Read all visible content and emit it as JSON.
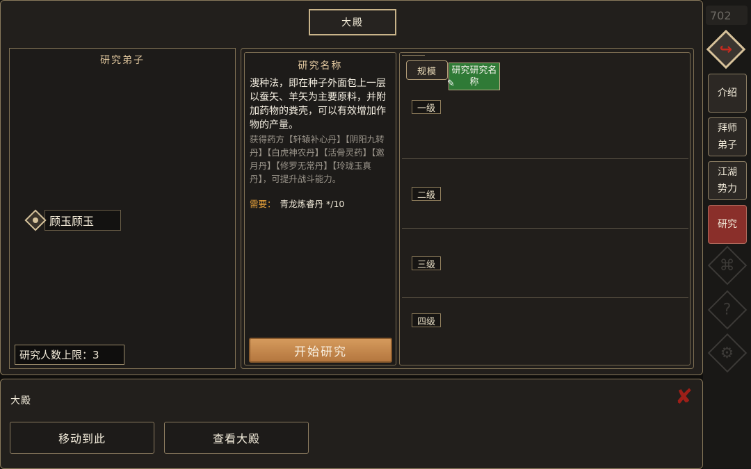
{
  "window": {
    "title": "大殿"
  },
  "disciples": {
    "header": "研究弟子",
    "items": [
      {
        "name": "顾玉顾玉"
      }
    ],
    "capacity_label": "研究人数上限：",
    "capacity_value": "3"
  },
  "research": {
    "header": "研究名称",
    "description": "溲种法，即在种子外面包上一层以蚕矢、羊矢为主要原料，并附加药物的粪壳，可以有效增加作物的产量。",
    "reward": "获得药方【轩辕补心丹】【阴阳九转丹】【白虎神农丹】【活骨灵药】【邀月丹】【修罗无常丹】【玲珑玉真丹】，可提升战斗能力。",
    "need_label": "需要：",
    "need_value": "青龙炼睿丹 */10",
    "start_button": "开始研究"
  },
  "tiers": {
    "scale_label": "规模",
    "slot_label": "研究研究名称",
    "levels": [
      "一级",
      "二级",
      "三级",
      "四级"
    ]
  },
  "side_nav": {
    "counter": "702",
    "items": [
      {
        "label": "介绍",
        "active": false
      },
      {
        "label": "拜师弟子",
        "active": false
      },
      {
        "label": "江湖势力",
        "active": false
      },
      {
        "label": "研究",
        "active": true
      }
    ],
    "icons": [
      "back-arrow-icon",
      "sect-icon",
      "help-icon",
      "settings-gear-icon"
    ]
  },
  "bottom": {
    "title": "大殿",
    "move_button": "移动到此",
    "view_button": "查看大殿"
  },
  "colors": {
    "accent_gold": "#c9b48a",
    "active_red": "#8a2f2a",
    "start_orange": "#c98a4e",
    "need_orange": "#e7a23b",
    "slot_green": "#2f7a36"
  }
}
